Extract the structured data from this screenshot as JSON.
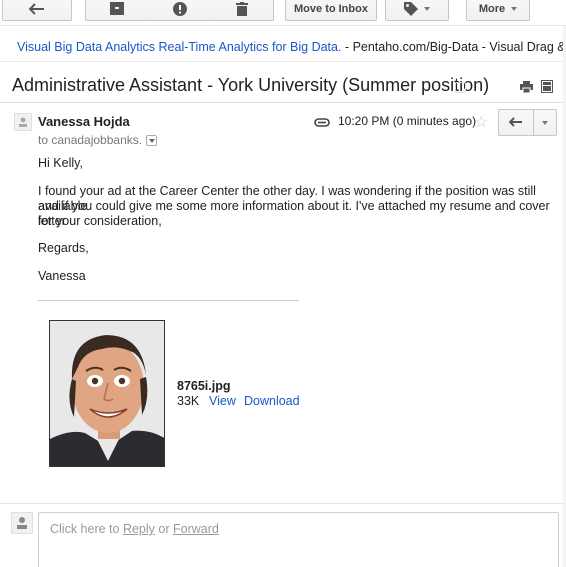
{
  "toolbar": {
    "move_to_inbox_label": "Move to Inbox",
    "more_label": "More"
  },
  "ad": {
    "link_text": "Visual Big Data Analytics Real-Time Analytics for Big Data.",
    "separator": " - ",
    "domain": "Pentaho.com/Big-Data",
    "description": " - Visual Drag & Drop Big"
  },
  "email": {
    "subject": "Administrative Assistant - York University (Summer position)",
    "sender_name": "Vanessa Hojda",
    "recipients": "to canadajobbanks.",
    "timestamp": "10:20 PM (0 minutes ago)",
    "body": {
      "greeting": "Hi Kelly,",
      "paragraph_line1": "I found your ad at the Career Center the other day. I was wondering if the position was still available",
      "paragraph_line2": "and if you could give me some more information about it. I've attached my resume and cover letter",
      "paragraph_line3": "for your consideration,",
      "closing": "Regards,",
      "signature": "Vanessa"
    }
  },
  "attachment": {
    "filename": "8765i.jpg",
    "size": "33K",
    "view_label": "View",
    "download_label": "Download"
  },
  "reply_area": {
    "prefix": "Click here to ",
    "reply": "Reply",
    "or": " or ",
    "forward": "Forward"
  },
  "colors": {
    "link": "#1a57c8",
    "text": "#222222",
    "muted": "#777777"
  }
}
